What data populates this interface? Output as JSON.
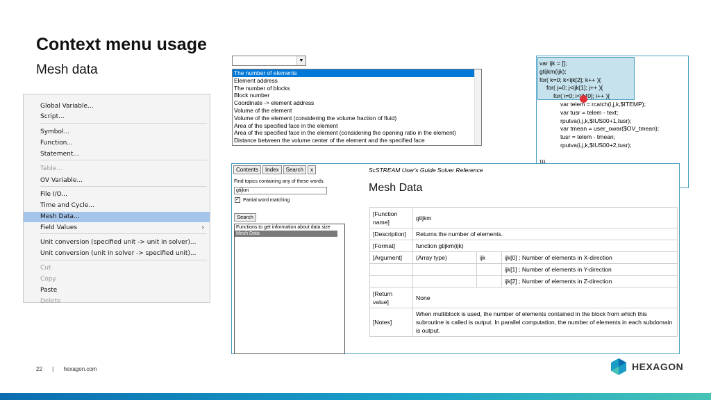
{
  "slide": {
    "title": "Context menu usage",
    "subtitle": "Mesh data",
    "page_number": "22",
    "separator": "|",
    "website": "hexagon.com",
    "logo_text": "HEXAGON"
  },
  "context_menu": {
    "items": [
      {
        "label": "Global Variable...",
        "disabled": false
      },
      {
        "label": "Script...",
        "disabled": false
      },
      {
        "label": "Symbol...",
        "disabled": false
      },
      {
        "label": "Function...",
        "disabled": false
      },
      {
        "label": "Statement...",
        "disabled": false
      },
      {
        "label": "Table...",
        "disabled": true
      },
      {
        "label": "OV Variable...",
        "disabled": false
      },
      {
        "label": "File I/O...",
        "disabled": false
      },
      {
        "label": "Time and Cycle...",
        "disabled": false
      },
      {
        "label": "Mesh Data...",
        "disabled": false,
        "selected": true
      },
      {
        "label": "Field Values",
        "disabled": false,
        "submenu_arrow": "›"
      },
      {
        "label": "Unit conversion (specified unit -> unit in solver)...",
        "disabled": false
      },
      {
        "label": "Unit conversion (unit in solver -> specified unit)...",
        "disabled": false
      },
      {
        "label": "Cut",
        "disabled": true
      },
      {
        "label": "Copy",
        "disabled": true
      },
      {
        "label": "Paste",
        "disabled": false
      },
      {
        "label": "Delete",
        "disabled": true
      }
    ]
  },
  "dropdown": {
    "value": "",
    "arrow": "▼"
  },
  "mesh_list": {
    "items": [
      "The number of elements",
      "Element address",
      "The number of blocks",
      "Block number",
      "Coordinate -> element address",
      "Volume of the element",
      "Volume of the element (considering the volume fraction of fluid)",
      "Area of the specified face in the element",
      "Area of the specified face in the element (considering the opening ratio in the element)",
      "Distance between the volume center of the element and the specified face"
    ],
    "selected_index": 0
  },
  "code": {
    "lines": [
      "var ijk = [];",
      "gtijkm(ijk);",
      "for( k=0; k<ijk[2]; k++ ){",
      "for( j=0; j<ijk[1]; j++ ){",
      "for( i=0; i<ijk[0]; i++ ){",
      "var telem = rcatch(i,j,k,$ITEMP);",
      "var tusr = telem - text;",
      "rputva(i,j,k,$IUS00+1,tusr);",
      "var tmean = user_owar($OV_tmean);",
      "tusr = telem - tmean;",
      "rputva(i,j,k,$IUS00+2,tusr);",
      "",
      "}}}",
      "}"
    ]
  },
  "help": {
    "tabs": [
      "Contents",
      "Index",
      "Search",
      "x"
    ],
    "find_label": "Find topics containing any of these words:",
    "search_value": "gtijkm",
    "partial_label": "Partial word matching",
    "partial_checked": "✓",
    "search_button": "Search",
    "results": [
      "Functions to get information about data size",
      "Mesh Data"
    ],
    "guide_title": "ScSTREAM User's Guide Solver Reference",
    "heading": "Mesh Data",
    "table": {
      "function_label": "[Function name]",
      "function_value": "gtijkm",
      "description_label": "[Description]",
      "description_value": "Returns the number of elements.",
      "format_label": "[Format]",
      "format_value": "function gtijkm(ijk)",
      "argument_label": "[Argument]",
      "argument_type": "(Array type)",
      "argument_name": "ijk",
      "argument_rows": [
        "ijk[0] ; Number of elements in X-direction",
        "ijk[1] ; Number of elements in Y-direction",
        "ijk[2] ; Number of elements in Z-direction"
      ],
      "return_label": "[Return value]",
      "return_value": "None",
      "notes_label": "[Notes]",
      "notes_value": "When multiblock is used, the number of elements contained in the block from which this subroutine is called is output. In parallel computation, the number of elements in each subdomain is output."
    }
  },
  "colors": {
    "accent": "#4a9fc1",
    "selection": "#a5c4ea",
    "list_selection": "#0078d7"
  }
}
